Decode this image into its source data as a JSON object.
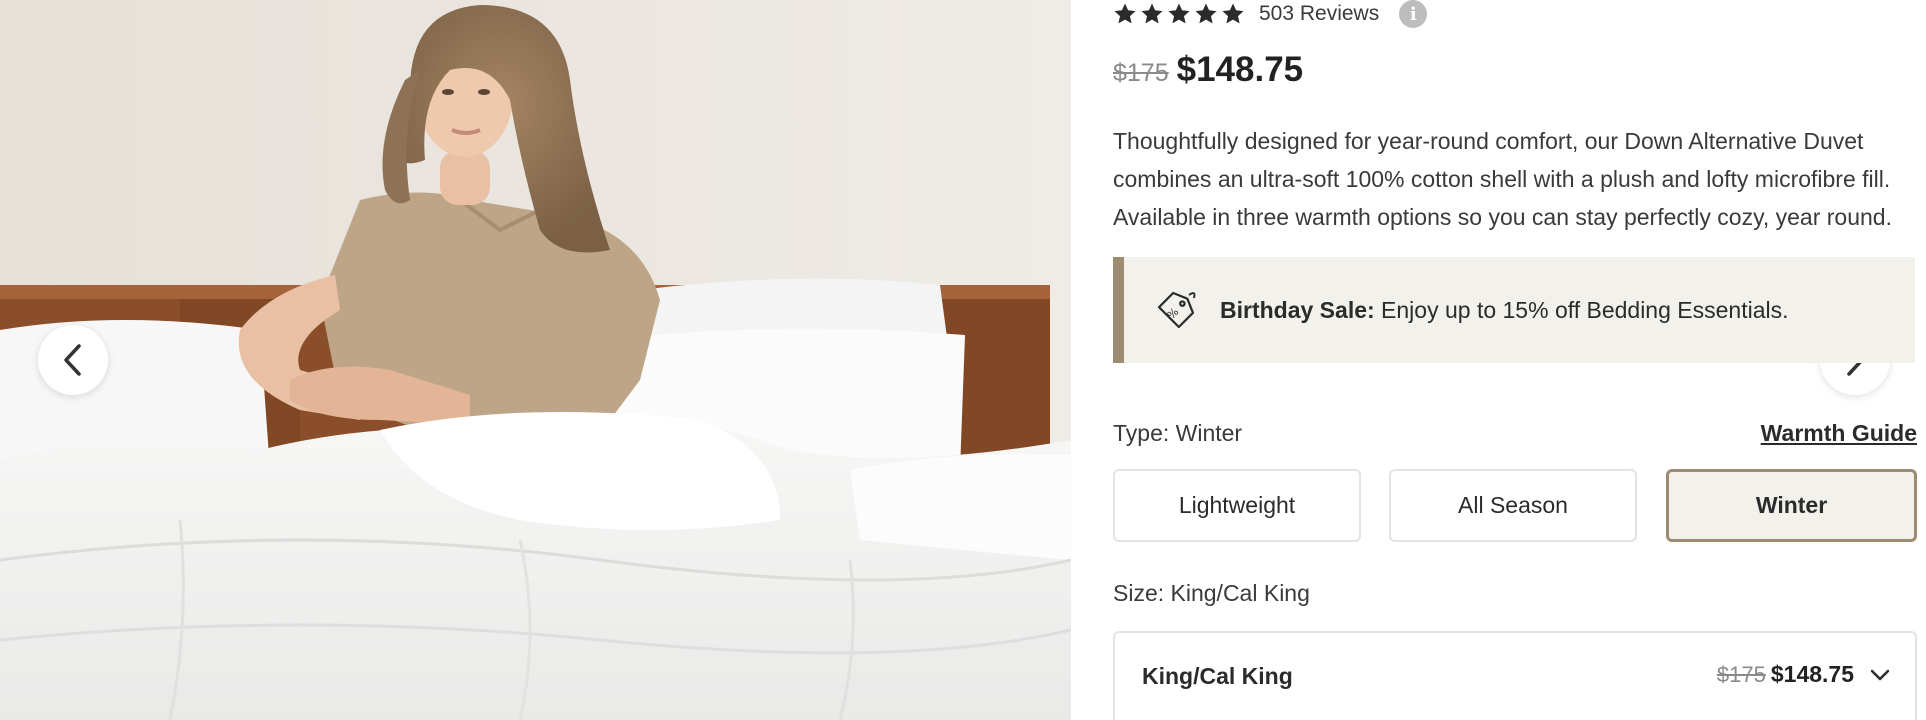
{
  "gallery": {
    "image_alt": "Woman sitting in bed with white down alternative duvet",
    "prev_icon": "chevron-left-icon",
    "next_icon": "chevron-right-icon"
  },
  "rating": {
    "stars": 5,
    "reviews_label": "503 Reviews",
    "info_icon": "info-icon",
    "info_glyph": "i"
  },
  "price": {
    "original": "$175",
    "sale": "$148.75"
  },
  "description": "Thoughtfully designed for year-round comfort, our Down Alternative Duvet combines an ultra-soft 100% cotton shell with a plush and lofty microfibre fill. Available in three warmth options so you can stay perfectly cozy, year round.",
  "promo": {
    "icon": "price-tag-icon",
    "title": "Birthday Sale:",
    "text": "Enjoy up to 15% off Bedding Essentials."
  },
  "type_selector": {
    "label": "Type: Winter",
    "guide_link": "Warmth Guide",
    "options": [
      "Lightweight",
      "All Season",
      "Winter"
    ],
    "selected": "Winter"
  },
  "size_selector": {
    "label": "Size: King/Cal King",
    "selected": "King/Cal King",
    "original_price": "$175",
    "sale_price": "$148.75",
    "icon": "chevron-down-icon"
  },
  "colors": {
    "accent": "#9d8c72",
    "promo_bg": "#f3f1ec",
    "text": "#2b2b2b",
    "muted": "#8a8a8a"
  }
}
